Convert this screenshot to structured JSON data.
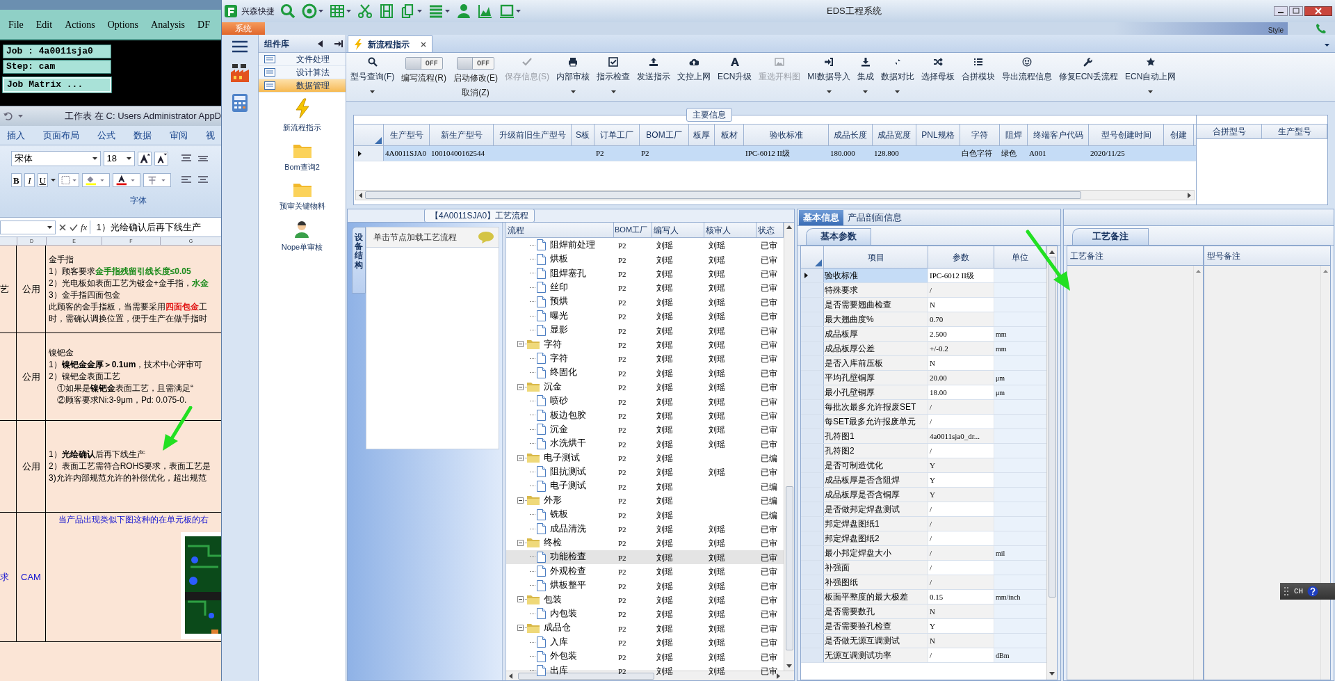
{
  "background": {
    "editor": {
      "menu": [
        "File",
        "Edit",
        "Actions",
        "Options",
        "Analysis",
        "DF"
      ],
      "job": "Job : 4a0011sja0",
      "step": "Step: cam",
      "job_matrix": "Job Matrix ..."
    },
    "spreadsheet": {
      "title": "工作表 在 C: Users Administrator AppD",
      "ribbon_tabs": [
        "插入",
        "页面布局",
        "公式",
        "数据",
        "审阅",
        "视"
      ],
      "font_name": "宋体",
      "font_size": "18",
      "format_buttons": [
        "B",
        "I",
        "U"
      ],
      "group_label": "字体",
      "formula_label": "fx",
      "formula": "1）光绘确认后再下线生产",
      "column_headers": [
        "D",
        "E",
        "F",
        "G"
      ],
      "rows": [
        {
          "kind": "spec",
          "category": "艺",
          "scope": "公用",
          "lines": [
            {
              "text": "金手指"
            },
            {
              "text": "1）顾客要求**金手指残留引线长度≤0.05**",
              "color": "#1a8a1a"
            },
            {
              "text": "2）光电板如表面工艺为镀金+金手指，**水金**",
              "color": "#1a8a1a"
            },
            {
              "text": "3）金手指四面包金"
            },
            {
              "text": "此顾客的金手指板，当需要采用**四面包金**工",
              "color": "#e01010"
            },
            {
              "text": "时，需确认调换位置，便于生产在做手指时"
            }
          ]
        },
        {
          "kind": "spec",
          "scope": "公用",
          "lines": [
            {
              "text": "镍钯金"
            },
            {
              "text": "1）**镍钯金金厚＞0.1um**，技术中心评审可"
            },
            {
              "text": "2）镍钯金表面工艺"
            },
            {
              "text": "　①如果是**镍钯金**表面工艺，且需满足“"
            },
            {
              "text": "　②顾客要求Ni:3-9μm，Pd: 0.075-0."
            }
          ]
        },
        {
          "kind": "spec",
          "scope": "公用",
          "lines": [
            {
              "text": "1）**光绘确认**后再下线生产"
            },
            {
              "text": "2）表面工艺需符合ROHS要求，表面工艺是"
            },
            {
              "text": "3)允许内部规范允许的补偿优化，超出规范"
            }
          ]
        },
        {
          "kind": "note",
          "category": "求",
          "scope": "CAM",
          "lines": [
            {
              "text": "当产品出现类似下图这种的在单元板的右"
            }
          ]
        }
      ]
    }
  },
  "window": {
    "quick_label": "兴森快捷",
    "title": "EDS工程系统",
    "menu_tab": "系统",
    "style_label": "Style"
  },
  "sidebar": {
    "title": "组件库",
    "items": [
      {
        "label": "文件处理",
        "selected": false
      },
      {
        "label": "设计算法",
        "selected": false
      },
      {
        "label": "数据管理",
        "selected": true
      }
    ],
    "tools": [
      "新流程指示",
      "Bom查询2",
      "预审关键物料",
      "Nope单审核"
    ]
  },
  "doc_tab": {
    "label": "新流程指示",
    "selected": true
  },
  "toolbar": {
    "items": [
      {
        "kind": "button",
        "label": "型号查询(F)",
        "dropdown": true,
        "disabled": false
      },
      {
        "kind": "toggle",
        "label": "编写流程(R)",
        "on": false,
        "state_text": "OFF"
      },
      {
        "kind": "toggle",
        "label": "启动修改(E)",
        "on": false,
        "state_text": "OFF",
        "secondary_label": "取消(Z)"
      },
      {
        "kind": "button",
        "label": "保存信息(S)",
        "dropdown": false,
        "disabled": true
      },
      {
        "kind": "button",
        "label": "内部审核",
        "dropdown": true,
        "disabled": false
      },
      {
        "kind": "button",
        "label": "指示检查",
        "dropdown": true,
        "disabled": false
      },
      {
        "kind": "button",
        "label": "发送指示",
        "dropdown": false,
        "disabled": false
      },
      {
        "kind": "button",
        "label": "文控上网",
        "dropdown": false,
        "disabled": false
      },
      {
        "kind": "button",
        "label": "ECN升级",
        "dropdown": false,
        "disabled": false
      },
      {
        "kind": "button",
        "label": "重选开料图",
        "dropdown": false,
        "disabled": true
      },
      {
        "kind": "button",
        "label": "MI数据导入",
        "dropdown": true,
        "disabled": false
      },
      {
        "kind": "button",
        "label": "集成",
        "dropdown": true,
        "disabled": false
      },
      {
        "kind": "button",
        "label": "数据对比",
        "dropdown": true,
        "disabled": false
      },
      {
        "kind": "button",
        "label": "选择母板",
        "dropdown": false,
        "disabled": false
      },
      {
        "kind": "button",
        "label": "合拼模块",
        "dropdown": false,
        "disabled": false
      },
      {
        "kind": "button",
        "label": "导出流程信息",
        "dropdown": false,
        "disabled": false
      },
      {
        "kind": "button",
        "label": "修复ECN丢流程",
        "dropdown": false,
        "disabled": false
      },
      {
        "kind": "button",
        "label": "ECN自动上网",
        "dropdown": true,
        "disabled": false
      }
    ]
  },
  "main_info": {
    "title": "主要信息",
    "columns": [
      "生产型号",
      "新生产型号",
      "升级前旧生产型号",
      "S板",
      "订单工厂",
      "BOM工厂",
      "板厚",
      "板材",
      "验收标准",
      "成品长度",
      "成品宽度",
      "PNL规格",
      "字符",
      "阻焊",
      "终端客户代码",
      "型号创建时间",
      "创建"
    ],
    "rows": [
      {
        "selected": true,
        "cells": [
          "4A0011SJA0",
          "10010400162544",
          null,
          null,
          "P2",
          "P2",
          null,
          null,
          "IPC-6012 II级",
          "180.000",
          "128.800",
          null,
          "白色字符",
          "绿色",
          "A001",
          "2020/11/25",
          null
        ]
      }
    ],
    "side_columns": [
      "合拼型号",
      "生产型号"
    ]
  },
  "process": {
    "title": "【4A0011SJA0】工艺流程",
    "side_tab": "设备结构",
    "hint": "单击节点加载工艺流程",
    "columns": [
      "流程",
      "BOM工厂",
      "编写人",
      "核审人",
      "状态"
    ],
    "tree": [
      {
        "children": [
          {
            "label": "阻焊前处理",
            "bom": "P2",
            "writer": "刘瑶",
            "reviewer": "刘瑶",
            "status": "已审",
            "selected": false
          },
          {
            "label": "烘板",
            "bom": "P2",
            "writer": "刘瑶",
            "reviewer": "刘瑶",
            "status": "已审",
            "selected": false
          },
          {
            "label": "阻焊塞孔",
            "bom": "P2",
            "writer": "刘瑶",
            "reviewer": "刘瑶",
            "status": "已审",
            "selected": false
          },
          {
            "label": "丝印",
            "bom": "P2",
            "writer": "刘瑶",
            "reviewer": "刘瑶",
            "status": "已审",
            "selected": false
          },
          {
            "label": "预烘",
            "bom": "P2",
            "writer": "刘瑶",
            "reviewer": "刘瑶",
            "status": "已审",
            "selected": false
          },
          {
            "label": "曝光",
            "bom": "P2",
            "writer": "刘瑶",
            "reviewer": "刘瑶",
            "status": "已审",
            "selected": false
          },
          {
            "label": "显影",
            "bom": "P2",
            "writer": "刘瑶",
            "reviewer": "刘瑶",
            "status": "已审",
            "selected": false
          }
        ]
      },
      {
        "label": "字符",
        "bom": "P2",
        "writer": "刘瑶",
        "reviewer": "刘瑶",
        "status": "已审",
        "selected": false,
        "expanded": true,
        "children": [
          {
            "label": "字符",
            "bom": "P2",
            "writer": "刘瑶",
            "reviewer": "刘瑶",
            "status": "已审",
            "selected": false
          },
          {
            "label": "终固化",
            "bom": "P2",
            "writer": "刘瑶",
            "reviewer": "刘瑶",
            "status": "已审",
            "selected": false
          }
        ]
      },
      {
        "label": "沉金",
        "bom": "P2",
        "writer": "刘瑶",
        "reviewer": "刘瑶",
        "status": "已审",
        "selected": false,
        "expanded": true,
        "children": [
          {
            "label": "喷砂",
            "bom": "P2",
            "writer": "刘瑶",
            "reviewer": "刘瑶",
            "status": "已审",
            "selected": false
          },
          {
            "label": "板边包胶",
            "bom": "P2",
            "writer": "刘瑶",
            "reviewer": "刘瑶",
            "status": "已审",
            "selected": false
          },
          {
            "label": "沉金",
            "bom": "P2",
            "writer": "刘瑶",
            "reviewer": "刘瑶",
            "status": "已审",
            "selected": false
          },
          {
            "label": "水洗烘干",
            "bom": "P2",
            "writer": "刘瑶",
            "reviewer": "刘瑶",
            "status": "已审",
            "selected": false
          }
        ]
      },
      {
        "label": "电子测试",
        "bom": "P2",
        "writer": "刘瑶",
        "status": "已编",
        "selected": false,
        "expanded": true,
        "children": [
          {
            "label": "阻抗测试",
            "bom": "P2",
            "writer": "刘瑶",
            "reviewer": "刘瑶",
            "status": "已审",
            "selected": false
          },
          {
            "label": "电子测试",
            "bom": "P2",
            "writer": "刘瑶",
            "status": "已编",
            "selected": false
          }
        ]
      },
      {
        "label": "外形",
        "bom": "P2",
        "writer": "刘瑶",
        "status": "已编",
        "selected": false,
        "expanded": true,
        "children": [
          {
            "label": "铣板",
            "bom": "P2",
            "writer": "刘瑶",
            "status": "已编",
            "selected": false
          },
          {
            "label": "成品清洗",
            "bom": "P2",
            "writer": "刘瑶",
            "reviewer": "刘瑶",
            "status": "已审",
            "selected": false
          }
        ]
      },
      {
        "label": "终检",
        "bom": "P2",
        "writer": "刘瑶",
        "reviewer": "刘瑶",
        "status": "已审",
        "selected": false,
        "expanded": true,
        "children": [
          {
            "label": "功能检查",
            "bom": "P2",
            "writer": "刘瑶",
            "reviewer": "刘瑶",
            "status": "已审",
            "selected": true
          },
          {
            "label": "外观检查",
            "bom": "P2",
            "writer": "刘瑶",
            "reviewer": "刘瑶",
            "status": "已审",
            "selected": false
          },
          {
            "label": "烘板整平",
            "bom": "P2",
            "writer": "刘瑶",
            "reviewer": "刘瑶",
            "status": "已审",
            "selected": false
          }
        ]
      },
      {
        "label": "包装",
        "bom": "P2",
        "writer": "刘瑶",
        "reviewer": "刘瑶",
        "status": "已审",
        "selected": false,
        "expanded": true,
        "children": [
          {
            "label": "内包装",
            "bom": "P2",
            "writer": "刘瑶",
            "reviewer": "刘瑶",
            "status": "已审",
            "selected": false
          }
        ]
      },
      {
        "label": "成品仓",
        "bom": "P2",
        "writer": "刘瑶",
        "reviewer": "刘瑶",
        "status": "已审",
        "selected": false,
        "expanded": true,
        "children": [
          {
            "label": "入库",
            "bom": "P2",
            "writer": "刘瑶",
            "reviewer": "刘瑶",
            "status": "已审",
            "selected": false
          },
          {
            "label": "外包装",
            "bom": "P2",
            "writer": "刘瑶",
            "reviewer": "刘瑶",
            "status": "已审",
            "selected": false
          },
          {
            "label": "出库",
            "bom": "P2",
            "writer": "刘瑶",
            "reviewer": "刘瑶",
            "status": "已审",
            "selected": false
          }
        ]
      }
    ]
  },
  "basic_info": {
    "tabs": [
      {
        "label": "基本信息",
        "selected": true
      },
      {
        "label": "产品剖面信息",
        "selected": false
      }
    ],
    "sub_tab": "基本参数",
    "columns": [
      "项目",
      "参数",
      "单位"
    ],
    "rows": [
      {
        "item": "验收标准",
        "value": "IPC-6012 II级",
        "selected": true
      },
      {
        "item": "特殊要求",
        "value": "/",
        "selected": false
      },
      {
        "item": "是否需要翘曲检查",
        "value": "N",
        "selected": false
      },
      {
        "item": "最大翘曲度%",
        "value": "0.70",
        "selected": false
      },
      {
        "item": "成品板厚",
        "value": "2.500",
        "unit": "mm",
        "selected": false
      },
      {
        "item": "成品板厚公差",
        "value": "+/-0.2",
        "unit": "mm",
        "selected": false
      },
      {
        "item": "是否入库前压板",
        "value": "N",
        "selected": false
      },
      {
        "item": "平均孔壁铜厚",
        "value": "20.00",
        "unit": "μm",
        "selected": false
      },
      {
        "item": "最小孔壁铜厚",
        "value": "18.00",
        "unit": "μm",
        "selected": false
      },
      {
        "item": "每批次最多允许报废SET",
        "value": "/",
        "selected": false
      },
      {
        "item": "每SET最多允许报废单元",
        "value": "/",
        "selected": false
      },
      {
        "item": "孔符图1",
        "value": "4a0011sja0_dr...",
        "selected": false
      },
      {
        "item": "孔符图2",
        "value": "/",
        "selected": false
      },
      {
        "item": "是否可制造优化",
        "value": "Y",
        "selected": false
      },
      {
        "item": "成品板厚是否含阻焊",
        "value": "Y",
        "selected": false
      },
      {
        "item": "成品板厚是否含铜厚",
        "value": "Y",
        "selected": false
      },
      {
        "item": "是否做邦定焊盘测试",
        "value": "/",
        "selected": false
      },
      {
        "item": "邦定焊盘图纸1",
        "value": "/",
        "selected": false
      },
      {
        "item": "邦定焊盘图纸2",
        "value": "/",
        "selected": false
      },
      {
        "item": "最小邦定焊盘大小",
        "value": "/",
        "unit": "mil",
        "selected": false
      },
      {
        "item": "补强面",
        "value": "/",
        "selected": false
      },
      {
        "item": "补强图纸",
        "value": "/",
        "selected": false
      },
      {
        "item": "板面平整度的最大极差",
        "value": "0.15",
        "unit": "mm/inch",
        "selected": false
      },
      {
        "item": "是否需要数孔",
        "value": "N",
        "selected": false
      },
      {
        "item": "是否需要验孔检查",
        "value": "Y",
        "selected": false
      },
      {
        "item": "是否做无源互调测试",
        "value": "N",
        "selected": false
      },
      {
        "item": "无源互调测试功率",
        "value": "/",
        "unit": "dBm",
        "selected": false
      }
    ]
  },
  "notes": {
    "sub_tab": "工艺备注",
    "columns": [
      "工艺备注",
      "型号备注"
    ]
  },
  "language_bar": {
    "label": "CH"
  }
}
